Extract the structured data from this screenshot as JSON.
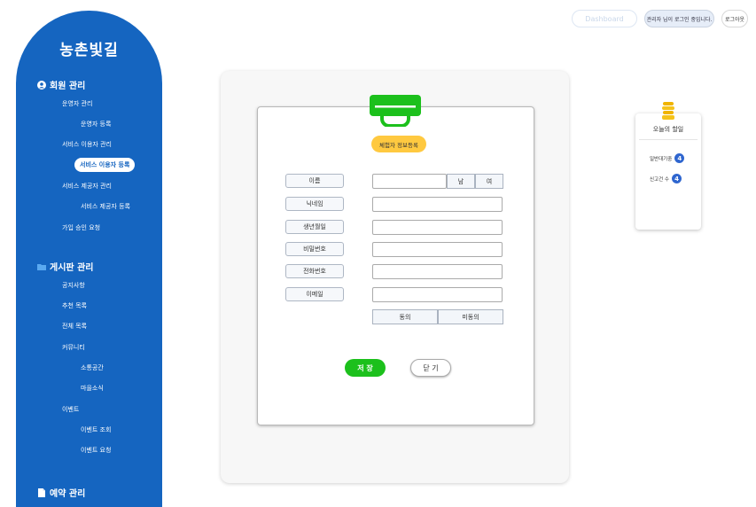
{
  "sidebar": {
    "logo": "농촌빛길",
    "member_section": "회원 관리",
    "member_items": [
      "운영자 관리",
      "운영자 등록",
      "서비스 이용자 관리",
      "서비스 이용자 등록",
      "서비스 제공자 관리",
      "서비스 제공자 등록",
      "가입 승인 요청"
    ],
    "board_section": "게시판 관리",
    "board_items": [
      "공지사항",
      "추천 목록",
      "전체 목록",
      "커뮤니티",
      "소통공간",
      "마을소식",
      "이벤트",
      "이벤트 조회",
      "이벤트 요청"
    ],
    "reservation_section": "예약 관리",
    "active_item": "서비스 이용자 등록"
  },
  "header": {
    "dashboard_label": "Dashboard",
    "welcome_text": "관리자 님이 로그인 중입니다.",
    "logout_label": "로그아웃"
  },
  "form": {
    "title": "체험자 정보등록",
    "fields": [
      {
        "label": "이름",
        "value": ""
      },
      {
        "label": "닉네임",
        "value": ""
      },
      {
        "label": "생년월일",
        "value": ""
      },
      {
        "label": "비밀번호",
        "value": ""
      },
      {
        "label": "전화번호",
        "value": ""
      },
      {
        "label": "이메일",
        "value": ""
      }
    ],
    "gender_male": "남",
    "gender_female": "여",
    "agree": "동의",
    "disagree": "미동의",
    "save": "저 장",
    "close": "닫 기"
  },
  "today": {
    "title": "오늘의 할일",
    "items": [
      {
        "label": "일반대기중",
        "count": "4"
      },
      {
        "label": "신고건 수",
        "count": "4"
      }
    ]
  },
  "colors": {
    "sidebar": "#1565c0",
    "save_button": "#1cc01c",
    "title_badge": "#ffc940",
    "count_badge": "#2f66cf"
  }
}
